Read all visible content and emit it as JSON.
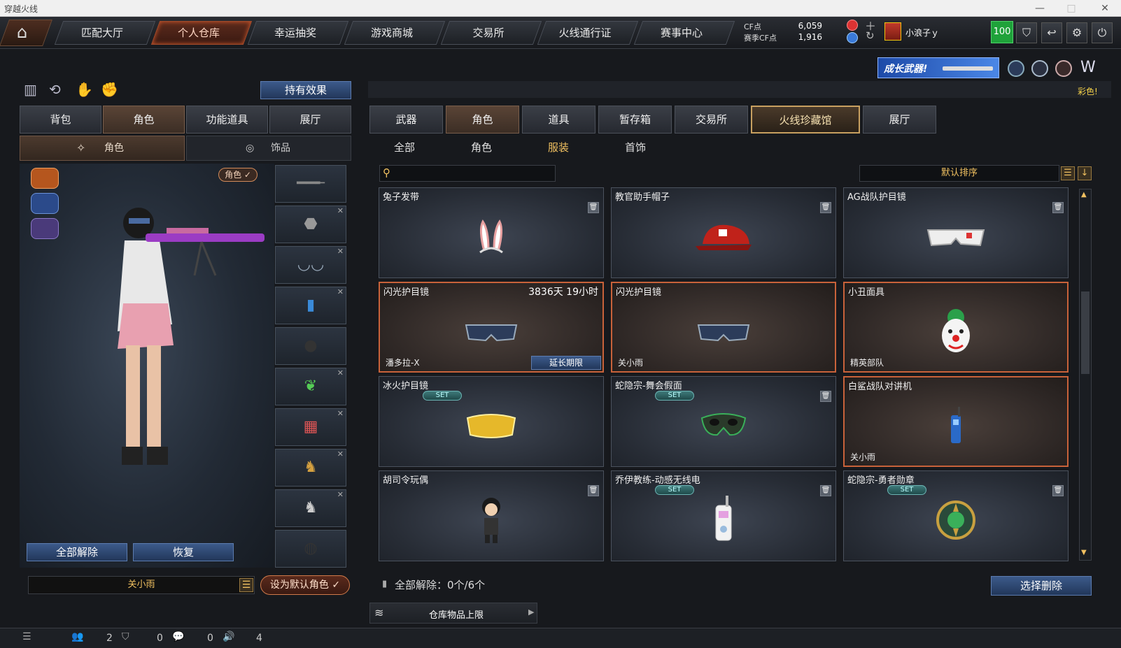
{
  "window": {
    "title": "穿越火线"
  },
  "topnav": {
    "tabs": [
      {
        "label": "匹配大厅"
      },
      {
        "label": "个人仓库"
      },
      {
        "label": "幸运抽奖"
      },
      {
        "label": "游戏商城"
      },
      {
        "label": "交易所"
      },
      {
        "label": "火线通行证"
      },
      {
        "label": "赛事中心"
      }
    ],
    "active_tab": "个人仓库",
    "cf_label": "CF点",
    "cf_value": "6,059",
    "season_cf_label": "赛季CF点",
    "season_cf_value": "1,916",
    "username": "小浪子ｙ",
    "level_badge": "100"
  },
  "banner": {
    "text": "成长武器!",
    "tag": "彩色!"
  },
  "left": {
    "hold_effect": "持有效果",
    "tabs": [
      "背包",
      "角色",
      "功能道具",
      "展厅"
    ],
    "active_tab": "角色",
    "subtabs": [
      "角色",
      "饰品"
    ],
    "active_subtab": "角色",
    "role_badge": "角色 ✓",
    "unequip_all": "全部解除",
    "restore": "恢复",
    "character_name": "关小雨",
    "set_default": "设为默认角色 ✓"
  },
  "right": {
    "tabs": [
      "武器",
      "角色",
      "道具",
      "暂存箱",
      "交易所",
      "火线珍藏馆",
      "展厅"
    ],
    "active_tab": "角色",
    "categories": [
      "全部",
      "角色",
      "服装",
      "首饰"
    ],
    "active_category": "服装",
    "sort_label": "默认排序",
    "search_placeholder": "",
    "items": [
      {
        "name": "兔子发带",
        "owner": "",
        "time": "",
        "set": false,
        "trash": true,
        "selected": false,
        "extend": false
      },
      {
        "name": "教官助手帽子",
        "owner": "",
        "time": "",
        "set": false,
        "trash": true,
        "selected": false,
        "extend": false
      },
      {
        "name": "AG战队护目镜",
        "owner": "",
        "time": "",
        "set": false,
        "trash": true,
        "selected": false,
        "extend": false
      },
      {
        "name": "闪光护目镜",
        "owner": "潘多拉-X",
        "time": "3836天 19小时",
        "set": false,
        "trash": false,
        "selected": true,
        "extend": true
      },
      {
        "name": "闪光护目镜",
        "owner": "关小雨",
        "time": "",
        "set": false,
        "trash": false,
        "selected": true,
        "extend": false
      },
      {
        "name": "小丑面具",
        "owner": "精英部队",
        "time": "",
        "set": false,
        "trash": false,
        "selected": true,
        "extend": false
      },
      {
        "name": "冰火护目镜",
        "owner": "",
        "time": "",
        "set": true,
        "trash": false,
        "selected": false,
        "extend": false
      },
      {
        "name": "蛇隐宗-舞会假面",
        "owner": "",
        "time": "",
        "set": true,
        "trash": true,
        "selected": false,
        "extend": false
      },
      {
        "name": "白鲨战队对讲机",
        "owner": "关小雨",
        "time": "",
        "set": false,
        "trash": false,
        "selected": true,
        "extend": false
      },
      {
        "name": "胡司令玩偶",
        "owner": "",
        "time": "",
        "set": false,
        "trash": true,
        "selected": false,
        "extend": false
      },
      {
        "name": "乔伊教练-动感无线电",
        "owner": "",
        "time": "",
        "set": true,
        "trash": true,
        "selected": false,
        "extend": false
      },
      {
        "name": "蛇隐宗-勇者勋章",
        "owner": "",
        "time": "",
        "set": true,
        "trash": true,
        "selected": false,
        "extend": false
      }
    ],
    "set_label": "SET",
    "extend_label": "延长期限",
    "footer_unequip": "全部解除：0个/6个",
    "select_delete": "选择删除",
    "storage_limit": "仓库物品上限"
  },
  "statusbar": {
    "friends": "2",
    "clan": "0",
    "chat": "0",
    "volume": "4"
  }
}
